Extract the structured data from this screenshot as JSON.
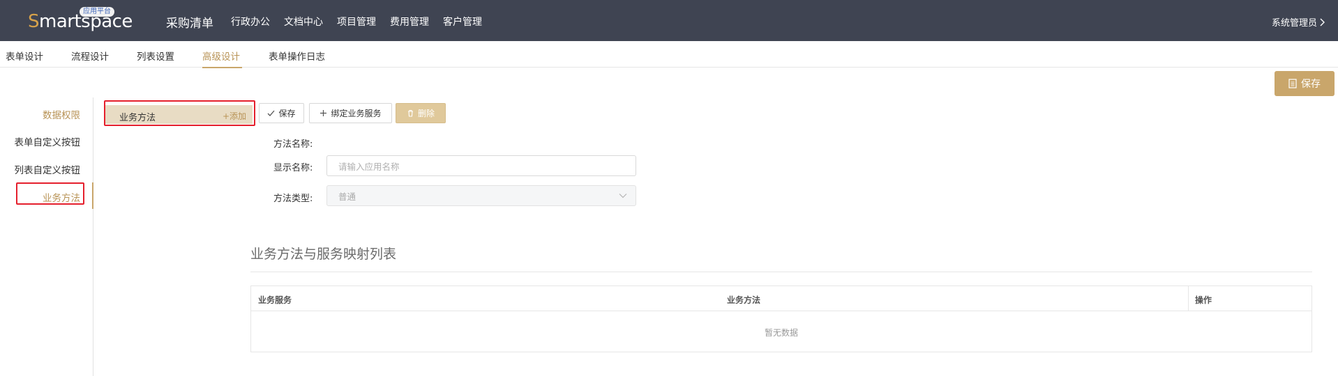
{
  "header": {
    "logo_text_s": "S",
    "logo_text_rest": "martspace",
    "logo_badge": "应用平台",
    "app_title": "采购清单",
    "nav": [
      "行政办公",
      "文档中心",
      "项目管理",
      "费用管理",
      "客户管理"
    ],
    "user": "系统管理员"
  },
  "subtabs": [
    {
      "label": "表单设计",
      "active": false
    },
    {
      "label": "流程设计",
      "active": false
    },
    {
      "label": "列表设置",
      "active": false
    },
    {
      "label": "高级设计",
      "active": true
    },
    {
      "label": "表单操作日志",
      "active": false
    }
  ],
  "top_save_label": "保存",
  "sidebar": {
    "items": [
      {
        "label": "数据权限"
      },
      {
        "label": "表单自定义按钮"
      },
      {
        "label": "列表自定义按钮"
      },
      {
        "label": "业务方法"
      }
    ]
  },
  "method_list": {
    "item_label": "业务方法",
    "add_label": "+添加"
  },
  "actions": {
    "save": "保存",
    "bind": "绑定业务服务",
    "delete": "删除"
  },
  "form": {
    "method_name_label": "方法名称:",
    "display_name_label": "显示名称:",
    "display_name_placeholder": "请输入应用名称",
    "method_type_label": "方法类型:",
    "method_type_value": "普通"
  },
  "mapping": {
    "title": "业务方法与服务映射列表",
    "columns": [
      "业务服务",
      "业务方法",
      "操作"
    ],
    "empty_text": "暂无数据"
  },
  "colors": {
    "topbar": "#3f4452",
    "accent": "#c9a66b",
    "highlight_box": "#e5202d"
  }
}
